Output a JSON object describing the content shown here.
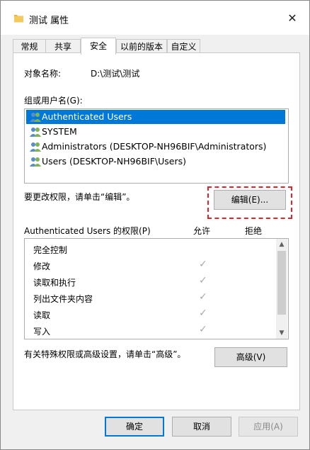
{
  "window": {
    "title": "测试 属性",
    "close_glyph": "✕"
  },
  "tabs": [
    {
      "label": "常规"
    },
    {
      "label": "共享"
    },
    {
      "label": "安全",
      "active": true
    },
    {
      "label": "以前的版本"
    },
    {
      "label": "自定义"
    }
  ],
  "security": {
    "object_name_label": "对象名称:",
    "object_name_value": "D:\\测试\\测试",
    "groups_label": "组或用户名(G):",
    "users": [
      {
        "name": "Authenticated Users",
        "icon": "users-group-icon",
        "selected": true
      },
      {
        "name": "SYSTEM",
        "icon": "users-group-icon"
      },
      {
        "name": "Administrators (DESKTOP-NH96BIF\\Administrators)",
        "icon": "users-group-icon"
      },
      {
        "name": "Users (DESKTOP-NH96BIF\\Users)",
        "icon": "users-group-icon"
      }
    ],
    "change_hint": "要更改权限，请单击“编辑”。",
    "edit_button": "编辑(E)...",
    "permissions_label": "Authenticated Users 的权限(P)",
    "allow_header": "允许",
    "deny_header": "拒绝",
    "permissions": [
      {
        "name": "完全控制",
        "allow": false
      },
      {
        "name": "修改",
        "allow": true
      },
      {
        "name": "读取和执行",
        "allow": true
      },
      {
        "name": "列出文件夹内容",
        "allow": true
      },
      {
        "name": "读取",
        "allow": true
      },
      {
        "name": "写入",
        "allow": true
      }
    ],
    "check_glyph": "✓",
    "advanced_hint": "有关特殊权限或高级设置，请单击“高级”。",
    "advanced_button": "高级(V)"
  },
  "footer": {
    "ok": "确定",
    "cancel": "取消",
    "apply": "应用(A)"
  },
  "colors": {
    "selection": "#0078d7",
    "highlight_dash": "#e0242b",
    "folder": "#e8b44a"
  }
}
